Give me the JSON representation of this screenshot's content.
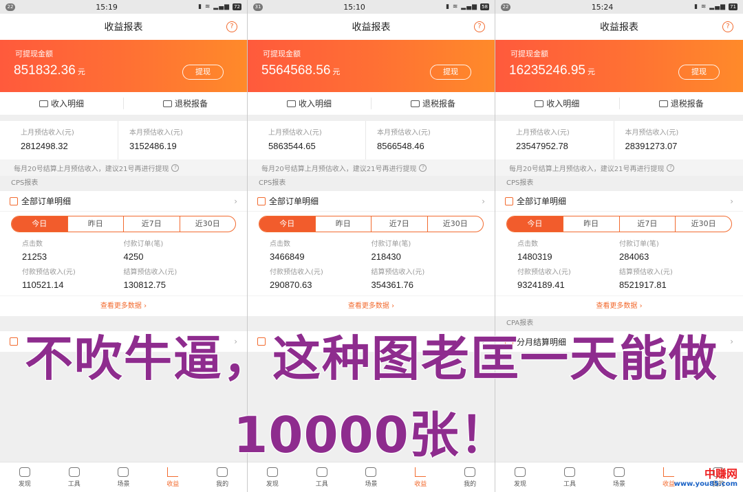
{
  "screens": [
    {
      "status": {
        "badge": "22",
        "time": "15:19",
        "battery": "72"
      },
      "title": "收益报表",
      "banner": {
        "label": "可提现金额",
        "amount": "851832.36",
        "unit": "元",
        "button": "提现"
      },
      "quick": [
        "收入明细",
        "退税报备"
      ],
      "estimate": {
        "last_label": "上月预估收入(元)",
        "last_value": "2812498.32",
        "this_label": "本月预估收入(元)",
        "this_value": "3152486.19"
      },
      "note": "每月20号结算上月预估收入，建议21号再进行提现",
      "cps_title": "CPS报表",
      "orders": "全部订单明细",
      "tabs": [
        "今日",
        "昨日",
        "近7日",
        "近30日"
      ],
      "stats": [
        {
          "label": "点击数",
          "value": "21253"
        },
        {
          "label": "付款订单(笔)",
          "value": "4250"
        },
        {
          "label": "付款预估收入(元)",
          "value": "110521.14"
        },
        {
          "label": "结算预估收入(元)",
          "value": "130812.75"
        }
      ],
      "more": "查看更多数据 ›",
      "cpa_title": "",
      "cpa_row": "",
      "tabbar": [
        "发现",
        "工具",
        "场景",
        "收益",
        "我的"
      ]
    },
    {
      "status": {
        "badge": "31",
        "time": "15:10",
        "battery": "58"
      },
      "title": "收益报表",
      "banner": {
        "label": "可提现金额",
        "amount": "5564568.56",
        "unit": "元",
        "button": "提现"
      },
      "quick": [
        "收入明细",
        "退税报备"
      ],
      "estimate": {
        "last_label": "上月预估收入(元)",
        "last_value": "5863544.65",
        "this_label": "本月预估收入(元)",
        "this_value": "8566548.46"
      },
      "note": "每月20号结算上月预估收入，建议21号再进行提现",
      "cps_title": "CPS报表",
      "orders": "全部订单明细",
      "tabs": [
        "今日",
        "昨日",
        "近7日",
        "近30日"
      ],
      "stats": [
        {
          "label": "点击数",
          "value": "3466849"
        },
        {
          "label": "付款订单(笔)",
          "value": "218430"
        },
        {
          "label": "付款预估收入(元)",
          "value": "290870.63"
        },
        {
          "label": "结算预估收入(元)",
          "value": "354361.76"
        }
      ],
      "more": "查看更多数据 ›",
      "cpa_title": "",
      "cpa_row": "",
      "tabbar": [
        "发现",
        "工具",
        "场景",
        "收益",
        "我的"
      ]
    },
    {
      "status": {
        "badge": "22",
        "time": "15:24",
        "battery": "71"
      },
      "title": "收益报表",
      "banner": {
        "label": "可提现金额",
        "amount": "16235246.95",
        "unit": "元",
        "button": "提现"
      },
      "quick": [
        "收入明细",
        "退税报备"
      ],
      "estimate": {
        "last_label": "上月预估收入(元)",
        "last_value": "23547952.78",
        "this_label": "本月预估收入(元)",
        "this_value": "28391273.07"
      },
      "note": "每月20号结算上月预估收入，建议21号再进行提现",
      "cps_title": "CPS报表",
      "orders": "全部订单明细",
      "tabs": [
        "今日",
        "昨日",
        "近7日",
        "近30日"
      ],
      "stats": [
        {
          "label": "点击数",
          "value": "1480319"
        },
        {
          "label": "付款订单(笔)",
          "value": "284063"
        },
        {
          "label": "付款预估收入(元)",
          "value": "9324189.41"
        },
        {
          "label": "结算预估收入(元)",
          "value": "8521917.81"
        }
      ],
      "more": "查看更多数据 ›",
      "cpa_title": "CPA报表",
      "cpa_row": "分月结算明细",
      "tabbar": [
        "发现",
        "工具",
        "场景",
        "收益",
        "我的"
      ]
    }
  ],
  "overlay": {
    "line1": "不吹牛逼，这种图老匡一天能做",
    "line2": "10000张！"
  },
  "watermark": {
    "name": "中赚网",
    "url": "www.you85.com"
  },
  "colors": {
    "accent": "#f26a2e",
    "overlay_text": "#8e2c8e"
  }
}
